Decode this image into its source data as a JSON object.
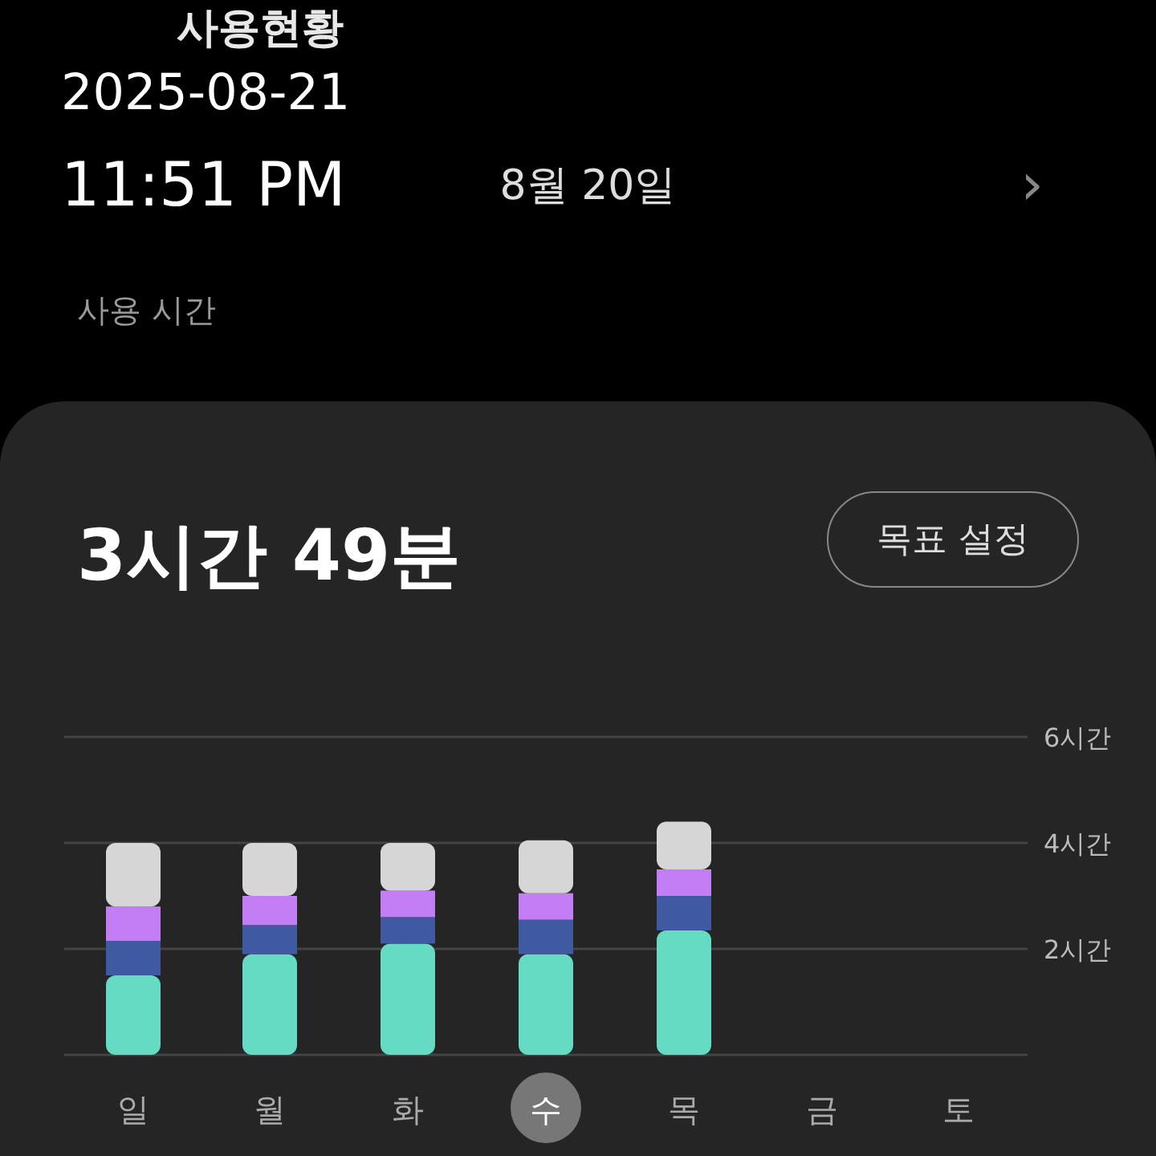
{
  "header": {
    "title": "사용현황",
    "date_stamp": "2025-08-21",
    "time_stamp": "11:51 PM",
    "day_label": "8월 20일",
    "next_icon": "›"
  },
  "section_label": "사용 시간",
  "card": {
    "total": "3시간 49분",
    "goal_button": "목표 설정",
    "days": [
      {
        "selected": false
      },
      {
        "selected": false
      },
      {
        "selected": false
      },
      {
        "selected": true
      },
      {
        "selected": false
      },
      {
        "selected": false
      },
      {
        "selected": false
      }
    ],
    "chart_data": {
      "type": "bar",
      "stacked": true,
      "categories": [
        "일",
        "월",
        "화",
        "수",
        "목",
        "금",
        "토"
      ],
      "yticks": [
        {
          "value": 2,
          "label": "2시간"
        },
        {
          "value": 4,
          "label": "4시간"
        },
        {
          "value": 6,
          "label": "6시간"
        }
      ],
      "ylim": [
        0,
        6
      ],
      "series": [
        {
          "color": "#66dbc4",
          "values": [
            1.5,
            1.9,
            2.1,
            1.9,
            2.35,
            null,
            null
          ]
        },
        {
          "color": "#3f5aa0",
          "values": [
            0.65,
            0.55,
            0.5,
            0.65,
            0.65,
            null,
            null
          ]
        },
        {
          "color": "#c47ef5",
          "values": [
            0.65,
            0.55,
            0.5,
            0.5,
            0.5,
            null,
            null
          ]
        },
        {
          "color": "#d6d6d6",
          "values": [
            1.2,
            1.0,
            0.9,
            1.0,
            0.9,
            null,
            null
          ]
        }
      ]
    }
  }
}
